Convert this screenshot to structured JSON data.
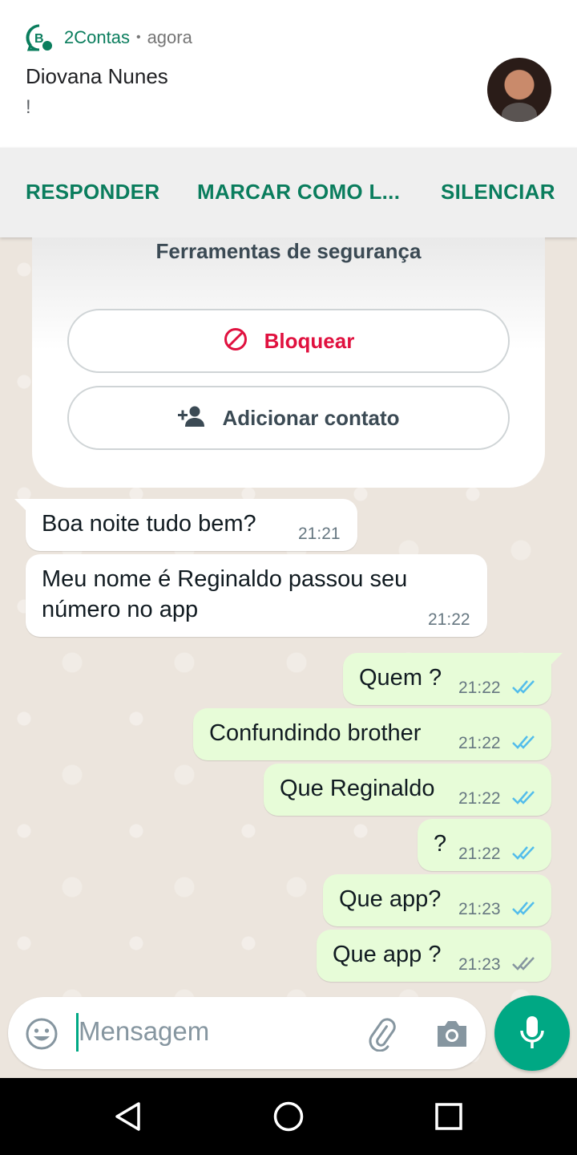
{
  "notification": {
    "app_name": "2Contas",
    "separator": "•",
    "time": "agora",
    "title": "Diovana Nunes",
    "text": "!",
    "actions": [
      "RESPONDER",
      "MARCAR COMO L...",
      "SILENCIAR"
    ]
  },
  "safety_card": {
    "title": "Ferramentas de segurança",
    "block_label": "Bloquear",
    "add_contact_label": "Adicionar contato"
  },
  "messages": [
    {
      "dir": "in",
      "text": "Boa noite tudo bem?",
      "time": "21:21"
    },
    {
      "dir": "in",
      "text_line1": "Meu nome é Reginaldo passou seu",
      "text_line2": "número no app",
      "time": "21:22"
    },
    {
      "dir": "out",
      "text": "Quem ?",
      "time": "21:22",
      "status": "read"
    },
    {
      "dir": "out",
      "text": "Confundindo brother",
      "time": "21:22",
      "status": "read"
    },
    {
      "dir": "out",
      "text": "Que Reginaldo",
      "time": "21:22",
      "status": "read"
    },
    {
      "dir": "out",
      "text": "?",
      "time": "21:22",
      "status": "read"
    },
    {
      "dir": "out",
      "text": "Que app?",
      "time": "21:23",
      "status": "read"
    },
    {
      "dir": "out",
      "text": "Que app ?",
      "time": "21:23",
      "status": "delivered"
    }
  ],
  "composer": {
    "placeholder": "Mensagem"
  },
  "icons": {
    "emoji": "emoji-icon",
    "attach": "paperclip-icon",
    "camera": "camera-icon",
    "mic": "microphone-icon",
    "back": "back-triangle-icon",
    "home": "home-circle-icon",
    "recents": "recents-square-icon"
  },
  "colors": {
    "accent": "#00a884",
    "brand_text": "#0a7d5d",
    "outgoing_bubble": "#e7fcd8",
    "read_ticks": "#53bdeb",
    "block_red": "#e0113f"
  }
}
